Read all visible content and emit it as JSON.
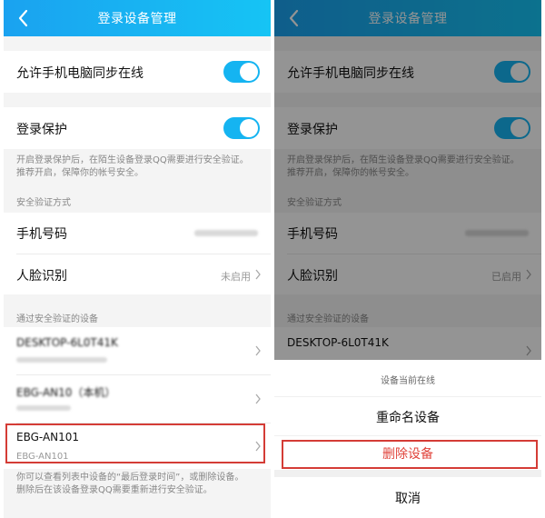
{
  "left": {
    "header": {
      "title": "登录设备管理"
    },
    "sync": {
      "label": "允许手机电脑同步在线",
      "enabled": true
    },
    "protect": {
      "label": "登录保护",
      "enabled": true
    },
    "protect_note": [
      "开启登录保护后，在陌生设备登录QQ需要进行安全验证。",
      "推荐开启，保障你的帐号安全。"
    ],
    "verify_section": "安全验证方式",
    "phone": {
      "label": "手机号码",
      "value": ""
    },
    "face": {
      "label": "人脸识别",
      "value": "未启用"
    },
    "devices_section": "通过安全验证的设备",
    "devices": [
      {
        "name": "DESKTOP-6L0T41K",
        "sub": ""
      },
      {
        "name": "EBG-AN10（本机）",
        "sub": ""
      },
      {
        "name": "EBG-AN101",
        "sub": "EBG-AN101"
      }
    ],
    "footer_note": [
      "你可以查看列表中设备的“最后登录时间”，或删除设备。",
      "删除后在该设备登录QQ需要重新进行安全验证。"
    ]
  },
  "right": {
    "header": {
      "title": "登录设备管理"
    },
    "sync_label": "允许手机电脑同步在线",
    "protect_label": "登录保护",
    "protect_note": [
      "开启登录保护后，在陌生设备登录QQ需要进行安全验证。",
      "推荐开启，保障你的帐号安全。"
    ],
    "verify_section": "安全验证方式",
    "phone_label": "手机号码",
    "face_label": "人脸识别",
    "face_value": "已启用",
    "devices_section": "通过安全验证的设备",
    "device_name": "DESKTOP-6L0T41K",
    "sheet": {
      "hint": "设备当前在线",
      "rename": "重命名设备",
      "delete": "删除设备",
      "cancel": "取消"
    }
  },
  "colors": {
    "accent": "#15b4f1",
    "danger": "#e0433b",
    "highlight_border": "#d43c36"
  }
}
